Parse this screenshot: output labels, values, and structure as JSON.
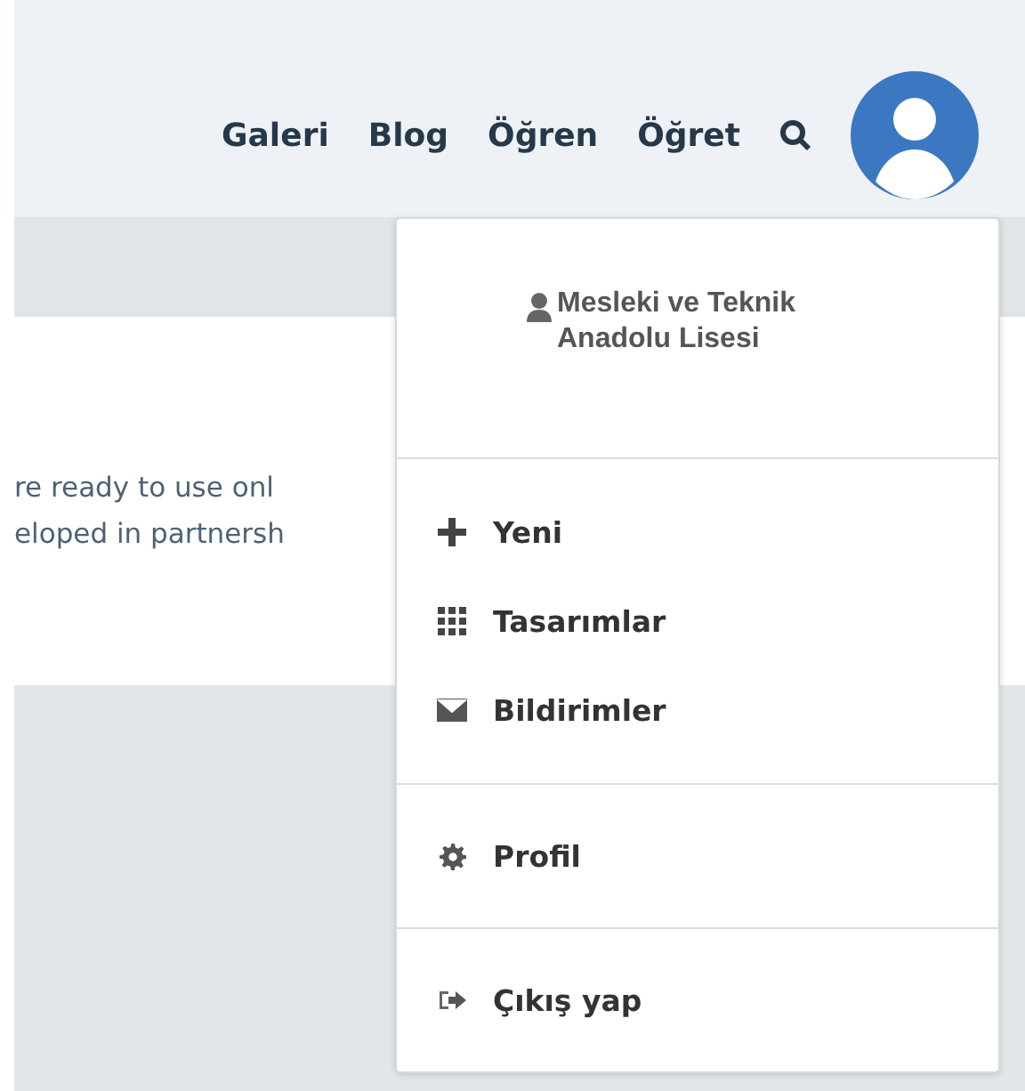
{
  "nav": {
    "links": [
      "Galeri",
      "Blog",
      "Öğren",
      "Öğret"
    ]
  },
  "content": {
    "lines": [
      "re ready to use onl",
      "eloped in partnersh"
    ]
  },
  "user_menu": {
    "user_name": "Mesleki ve Teknik Anadolu Lisesi",
    "sections": [
      [
        {
          "label": "Yeni"
        },
        {
          "label": "Tasarımlar"
        },
        {
          "label": "Bildirimler"
        }
      ],
      [
        {
          "label": "Profil"
        }
      ],
      [
        {
          "label": "Çıkış yap"
        }
      ]
    ]
  }
}
